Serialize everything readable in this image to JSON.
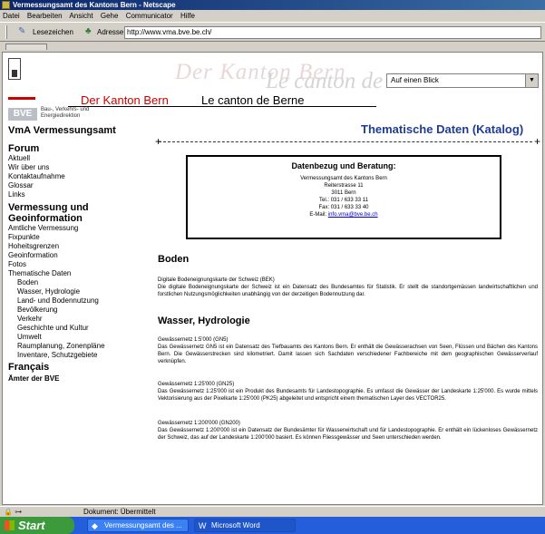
{
  "window": {
    "title": "Vermessungsamt des Kantons Bern - Netscape"
  },
  "menubar": {
    "items": [
      "Datei",
      "Bearbeiten",
      "Ansicht",
      "Gehe",
      "Communicator",
      "Hilfe"
    ]
  },
  "location": {
    "bookmarks_label": "Lesezeichen",
    "address_label": "Adresse:",
    "url": "http://www.vma.bve.be.ch/"
  },
  "header": {
    "ghost_de": "Der Kanton Bern",
    "ghost_fr": "Le canton de Berne",
    "kanton_de": "Der Kanton Bern",
    "kanton_fr": "Le canton de Berne",
    "select_value": "Auf einen Blick"
  },
  "bve": {
    "badge": "BVE",
    "line1": "Bau-, Verkehrs- und",
    "line2": "Energiedirektion"
  },
  "vma_title": "VmA  Vermessungsamt",
  "sidebar": {
    "forum": "Forum",
    "forum_items": [
      "Aktuell",
      "Wir über uns",
      "Kontaktaufnahme",
      "Glossar",
      "Links"
    ],
    "geo_heading": "Vermessung und Geoinformation",
    "geo_items": [
      "Amtliche Vermessung",
      "Fixpunkte",
      "Hoheitsgrenzen",
      "Geoinformation",
      "Fotos",
      "Thematische Daten"
    ],
    "sub_items": [
      "Boden",
      "Wasser, Hydrologie",
      "Land- und Bodennutzung",
      "Bevölkerung",
      "Verkehr",
      "Geschichte und Kultur",
      "Umwelt",
      "Raumplanung, Zonenpläne",
      "Inventare, Schutzgebiete"
    ],
    "francais": "Français",
    "aemter": "Ämter der BVE"
  },
  "main": {
    "heading": "Thematische Daten (Katalog)",
    "infobox": {
      "title": "Datenbezug und Beratung:",
      "lines": [
        "Vermessungsamt des Kantons Bern",
        "Reiterstrasse 11",
        "3011 Bern",
        "Tel.: 031 / 633 33 11",
        "Fax: 031 / 633 33 40"
      ],
      "email_label": "E-Mail:",
      "email": "info.vma@bve.be.ch"
    },
    "boden": {
      "heading": "Boden",
      "p1_title": "Digitale Bodeneignungskarte der Schweiz (BEK)",
      "p1_text": "Die digitale Bodeneignungskarte der Schweiz ist ein Datensatz des Bundesamtes für Statistik. Er stellt die standortgemässen landwirtschaftlichen und forstlichen Nutzungsmöglichkeiten unabhängig von der derzeitigen Bodennutzung dar."
    },
    "wasser": {
      "heading": "Wasser, Hydrologie",
      "p1_title": "Gewässernetz 1:5'000 (GN5)",
      "p1_text": "Das Gewässernetz GN5 ist ein Datensatz des Tiefbauamts des Kantons Bern. Er enthält die Gewässerachsen von Seen, Flüssen und Bächen des Kantons Bern. Die Gewässerstrecken sind kilometriert. Damit lassen sich Sachdaten verschiedener Fachbereiche mit dem geographischen Gewässerverlauf verknüpfen.",
      "p2_title": "Gewässernetz 1:25'000 (GN25)",
      "p2_text": "Das Gewässernetz 1:25'000 ist ein Produkt des Bundesamts für Landestopographie. Es umfasst die Gewässer der Landeskarte 1:25'000. Es wurde mittels Vektorisierung aus der Pixelkarte 1:25'000 (PK25) abgeleitet und entspricht einem thematischen Layer des VECTOR25.",
      "p3_title": "Gewässernetz 1:200'000 (GN200)",
      "p3_text": "Das Gewässernetz 1:200'000 ist ein Datensatz der Bundesämter für Wasserwirtschaft und für Landestopographie. Er enthält ein lückenloses Gewässernetz der Schweiz, das auf der Landeskarte 1:200'000 basiert. Es können Fliessgewässer und Seen unterschieden werden."
    }
  },
  "statusbar": {
    "text": "Dokument: Übermittelt"
  },
  "taskbar": {
    "start": "Start",
    "task1": "Vermessungsamt des ...",
    "task2": "Microsoft Word"
  }
}
